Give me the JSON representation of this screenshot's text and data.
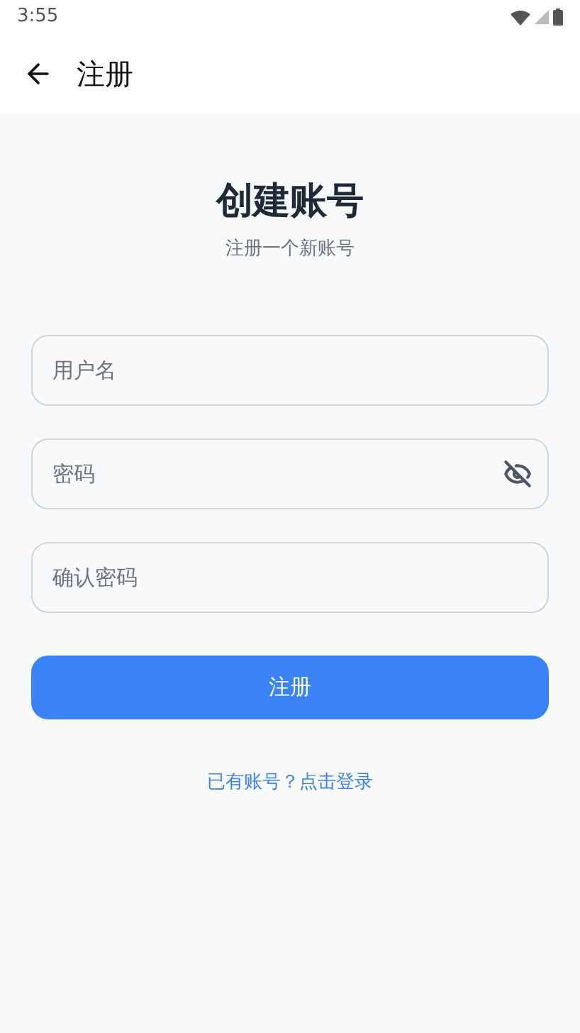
{
  "status_bar": {
    "time": "3:55"
  },
  "app_bar": {
    "title": "注册"
  },
  "header": {
    "title": "创建账号",
    "subtitle": "注册一个新账号"
  },
  "fields": [
    {
      "kind": "text",
      "placeholder": "用户名"
    },
    {
      "kind": "password",
      "placeholder": "密码",
      "password_visible": false
    },
    {
      "kind": "text",
      "placeholder": "确认密码"
    }
  ],
  "submit_button": "注册",
  "login_link": "已有账号？点击登录"
}
